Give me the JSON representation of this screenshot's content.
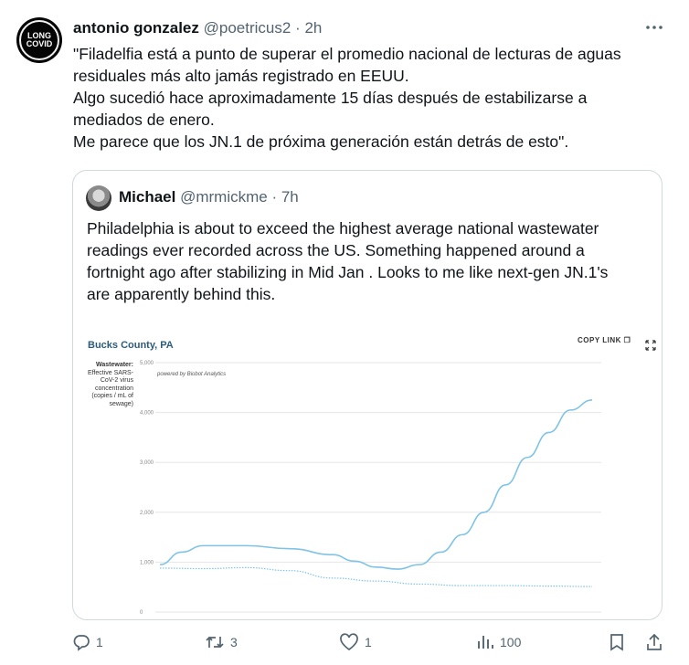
{
  "tweet": {
    "avatar_text": [
      "LONG",
      "COVID"
    ],
    "author_name": "antonio gonzalez",
    "author_handle": "@poetricus2",
    "separator": " · ",
    "time": "2h",
    "text_lines": [
      "\"Filadelfia está a punto de superar el promedio nacional de lecturas de aguas",
      "residuales más alto jamás registrado en EEUU.",
      "Algo sucedió hace aproximadamente 15 días después de estabilizarse a",
      "mediados de enero.",
      "Me parece que los JN.1 de próxima generación están detrás de esto\"."
    ]
  },
  "quote": {
    "author_name": "Michael",
    "author_handle": "@mrmickme",
    "separator": " · ",
    "time": "7h",
    "text_lines": [
      "Philadelphia is about to exceed the highest average national wastewater",
      "readings ever recorded across the US. Something happened around a",
      "fortnight ago after stabilizing in Mid Jan . Looks to me like next-gen JN.1's",
      "are apparently behind this."
    ]
  },
  "chart": {
    "title": "Bucks County, PA",
    "copy_link": "COPY LINK",
    "ylabel_bold": "Wastewater:",
    "ylabel_rest": [
      "Effective SARS-",
      "CoV-2 virus",
      "concentration",
      "(copies / mL of",
      "sewage)"
    ],
    "powered": "powered by Biobot Analytics"
  },
  "chart_data": {
    "type": "line",
    "ylim": [
      0,
      5000
    ],
    "yticks": [
      "5,000",
      "4,000",
      "3,000",
      "2,000",
      "1,000",
      "0"
    ],
    "grid": true,
    "series": [
      {
        "style": "solid",
        "color": "#7fc3e6",
        "x": [
          0,
          5,
          10,
          20,
          30,
          40,
          45,
          50,
          55,
          60,
          65,
          70,
          75,
          80,
          85,
          90,
          95,
          100
        ],
        "y": [
          950,
          1200,
          1330,
          1330,
          1270,
          1150,
          1020,
          900,
          860,
          950,
          1200,
          1550,
          2000,
          2550,
          3100,
          3600,
          4050,
          4250
        ]
      },
      {
        "style": "dotted",
        "color": "#7fc3e6",
        "x": [
          0,
          10,
          20,
          30,
          40,
          50,
          60,
          70,
          80,
          90,
          100
        ],
        "y": [
          880,
          870,
          890,
          830,
          680,
          620,
          560,
          530,
          530,
          520,
          510
        ]
      }
    ]
  },
  "actions": {
    "replies": "1",
    "retweets": "3",
    "likes": "1",
    "views": "100"
  }
}
